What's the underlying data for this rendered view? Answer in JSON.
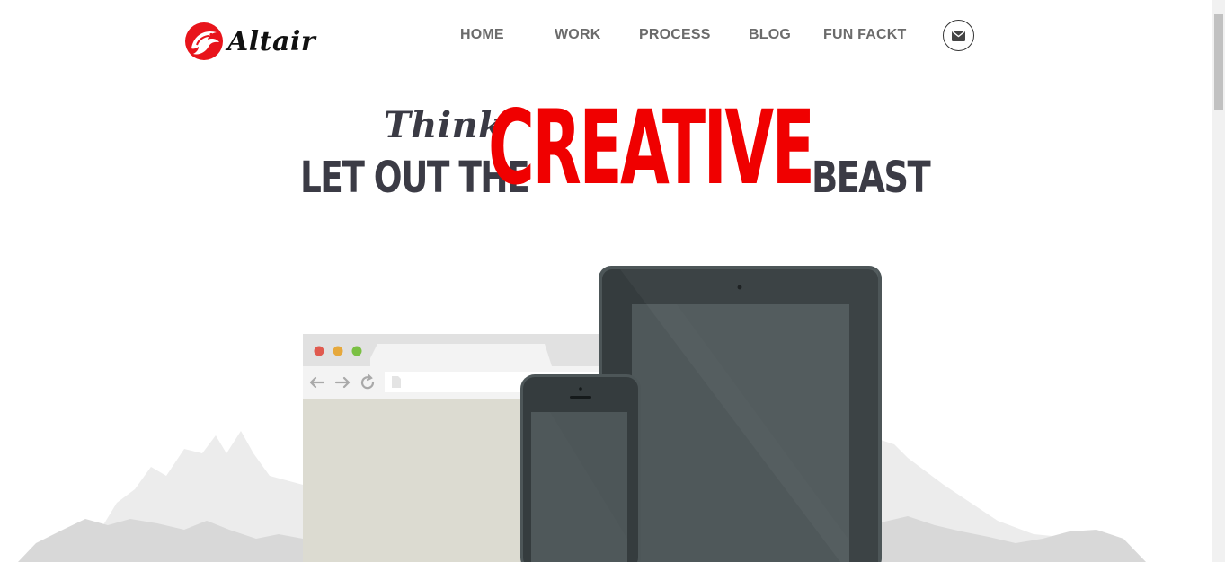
{
  "header": {
    "logo_text": "Altair",
    "nav": [
      {
        "label": "HOME"
      },
      {
        "label": "WORK"
      },
      {
        "label": "PROCESS"
      },
      {
        "label": "BLOG"
      },
      {
        "label": "FUN FACKT"
      }
    ],
    "contact_icon": "envelope-icon"
  },
  "hero": {
    "think": "Think",
    "prefix": "LET OUT THE",
    "highlight": "CREATIVE",
    "suffix": "BEAST"
  },
  "colors": {
    "accent": "#f00000",
    "text_dark": "#3b3b45",
    "nav_text": "#6b6b6b"
  },
  "illustration": {
    "devices": [
      "browser-window",
      "tablet",
      "smartphone"
    ],
    "browser_buttons": [
      "close",
      "minimize",
      "maximize"
    ],
    "browser_nav_icons": [
      "back-arrow-icon",
      "forward-arrow-icon",
      "reload-icon",
      "document-icon"
    ]
  }
}
